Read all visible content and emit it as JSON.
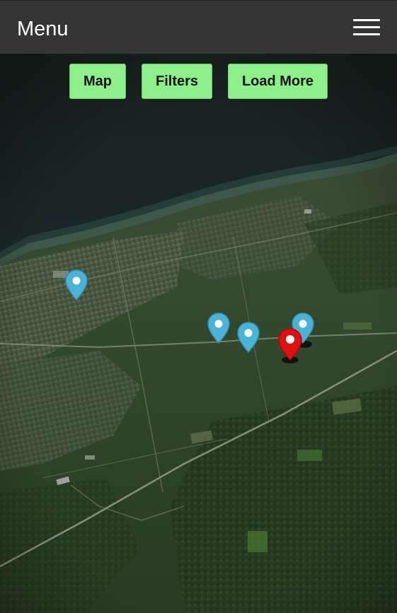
{
  "header": {
    "title": "Menu",
    "menu_icon": "hamburger-icon"
  },
  "toolbar": {
    "buttons": [
      {
        "label": "Map"
      },
      {
        "label": "Filters"
      },
      {
        "label": "Load More"
      }
    ]
  },
  "map": {
    "view": "satellite-3d",
    "markers": [
      {
        "color": "#4ab4d6",
        "icon": "map-pin-icon"
      },
      {
        "color": "#4ab4d6",
        "icon": "map-pin-icon"
      },
      {
        "color": "#4ab4d6",
        "icon": "map-pin-icon"
      },
      {
        "color": "#4ab4d6",
        "icon": "map-pin-icon"
      },
      {
        "color": "#e01010",
        "icon": "map-pin-icon",
        "selected": true
      }
    ]
  },
  "colors": {
    "header_bg": "#353535",
    "button_bg": "#8ef08a",
    "water": "#1e2a2c",
    "land": "#2f4a2c"
  }
}
